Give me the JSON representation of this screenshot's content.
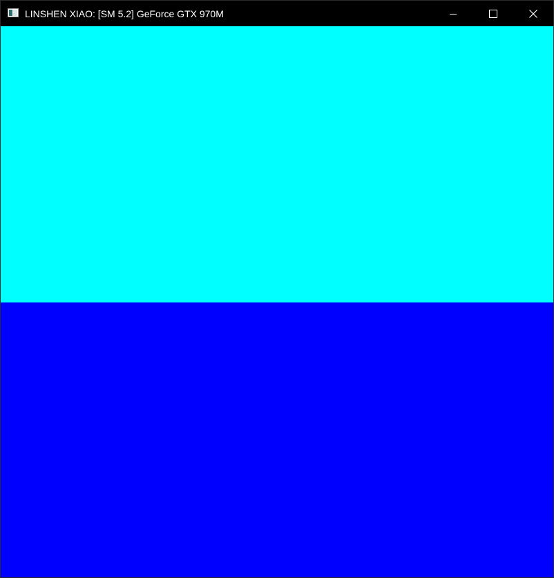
{
  "window": {
    "title": "LINSHEN XIAO: [SM 5.2] GeForce GTX 970M",
    "icon": "application-window-icon",
    "controls": {
      "minimize": "minimize-icon",
      "maximize": "maximize-icon",
      "close": "close-icon"
    }
  },
  "canvas": {
    "top_color": "#00FFFF",
    "bottom_color": "#0000FF"
  }
}
